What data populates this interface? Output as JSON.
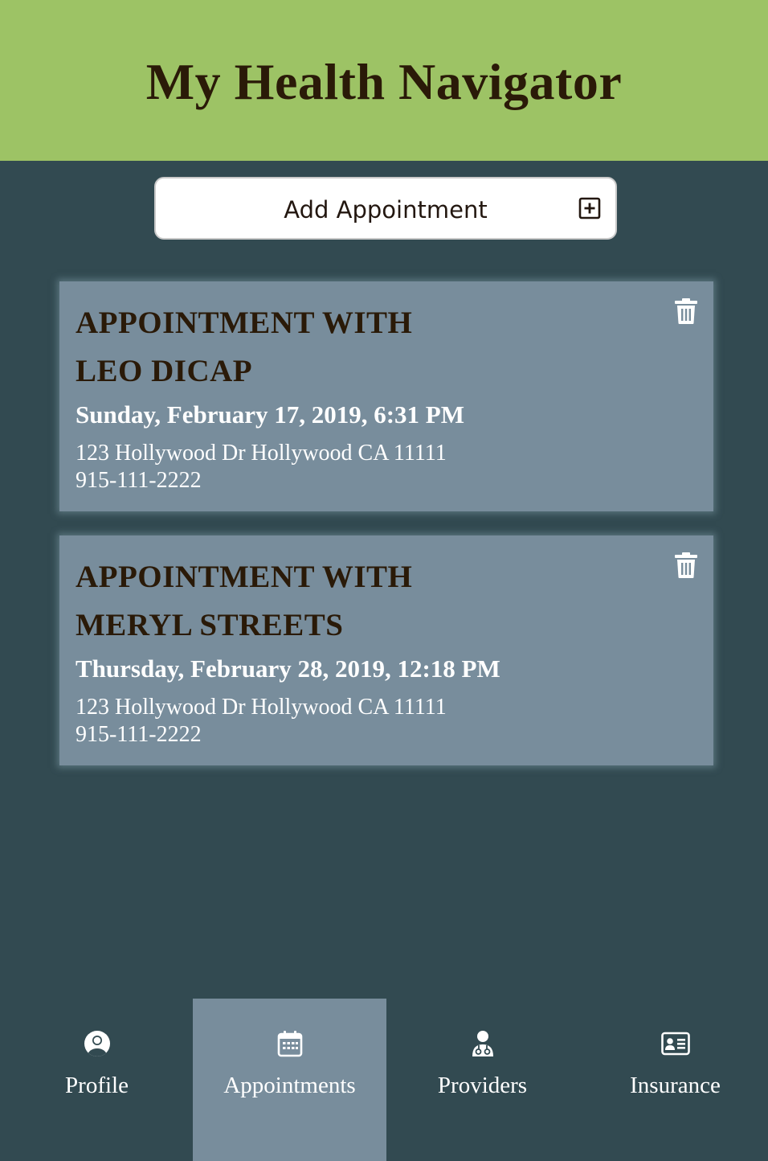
{
  "header": {
    "title": "My Health Navigator"
  },
  "add_button": {
    "label": "Add Appointment"
  },
  "appointments": [
    {
      "title_line1": "APPOINTMENT WITH",
      "title_line2": "LEO DICAP",
      "datetime": "Sunday, February 17, 2019, 6:31 PM",
      "address": "123 Hollywood Dr Hollywood CA 11111",
      "phone": "915-111-2222"
    },
    {
      "title_line1": "APPOINTMENT WITH",
      "title_line2": "MERYL STREETS",
      "datetime": "Thursday, February 28, 2019, 12:18 PM",
      "address": "123 Hollywood Dr Hollywood CA 11111",
      "phone": "915-111-2222"
    }
  ],
  "nav": {
    "items": [
      {
        "label": "Profile",
        "icon": "user-circle-icon",
        "active": false
      },
      {
        "label": "Appointments",
        "icon": "calendar-icon",
        "active": true
      },
      {
        "label": "Providers",
        "icon": "doctor-icon",
        "active": false
      },
      {
        "label": "Insurance",
        "icon": "id-card-icon",
        "active": false
      }
    ]
  },
  "colors": {
    "header_bg": "#9dc365",
    "page_bg": "#324a51",
    "card_bg": "#788d9c",
    "title_text": "#2a1a08",
    "active_nav_bg": "#788d9c"
  }
}
